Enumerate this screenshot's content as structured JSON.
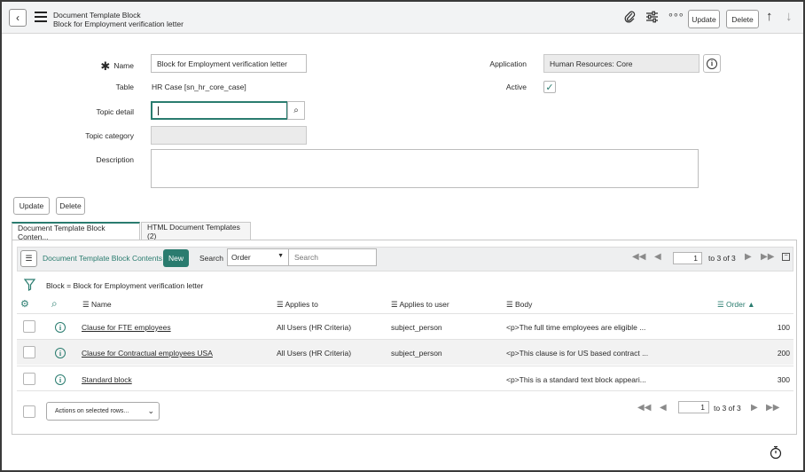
{
  "header": {
    "record_type": "Document Template Block",
    "record_name": "Block for Employment verification letter",
    "update_label": "Update",
    "delete_label": "Delete"
  },
  "form": {
    "name_label": "Name",
    "name_value": "Block for Employment verification letter",
    "table_label": "Table",
    "table_value": "HR Case [sn_hr_core_case]",
    "topic_detail_label": "Topic detail",
    "topic_detail_value": "",
    "topic_category_label": "Topic category",
    "topic_category_value": "",
    "description_label": "Description",
    "description_value": "",
    "application_label": "Application",
    "application_value": "Human Resources: Core",
    "active_label": "Active",
    "active_checked": true,
    "update_label": "Update",
    "delete_label": "Delete"
  },
  "tabs": [
    {
      "label": "Document Template Block Conten..."
    },
    {
      "label": "HTML Document Templates (2)"
    }
  ],
  "list": {
    "title": "Document Template Block Contents",
    "new_label": "New",
    "search_label": "Search",
    "search_field": "Order",
    "search_placeholder": "Search",
    "breadcrumb": "Block = Block for Employment verification letter",
    "page_value": "1",
    "page_total": "to 3 of 3",
    "columns": [
      "Name",
      "Applies to",
      "Applies to user",
      "Body",
      "Order"
    ],
    "rows": [
      {
        "name": "Clause for FTE employees",
        "applies_to": "All Users (HR Criteria)",
        "applies_to_user": "subject_person",
        "body": "<p>The full time employees are eligible ...",
        "order": "100"
      },
      {
        "name": "Clause for Contractual employees USA",
        "applies_to": "All Users (HR Criteria)",
        "applies_to_user": "subject_person",
        "body": "<p>This clause is for US based contract ...",
        "order": "200"
      },
      {
        "name": "Standard block",
        "applies_to": "",
        "applies_to_user": "",
        "body": "<p>This is a standard text block appeari...",
        "order": "300"
      }
    ],
    "actions_label": "Actions on selected rows..."
  },
  "colors": {
    "accent": "#2a7c6f",
    "header_bg": "#f2f3f4"
  }
}
